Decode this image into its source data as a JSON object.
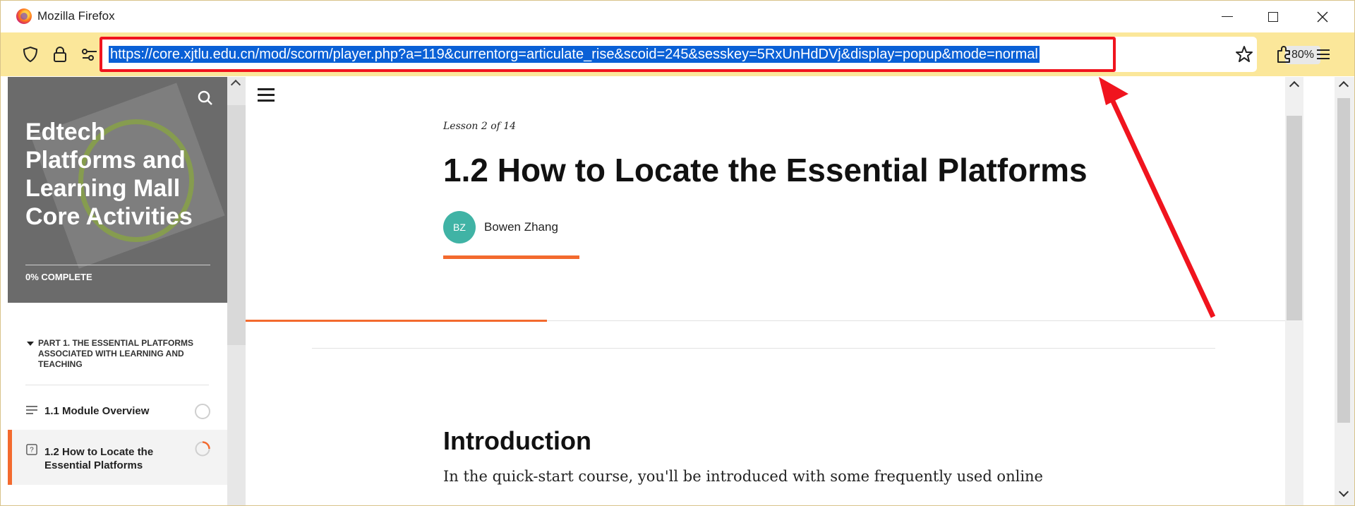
{
  "window": {
    "title": "Mozilla Firefox"
  },
  "navbar": {
    "url": "https://core.xjtlu.edu.cn/mod/scorm/player.php?a=119&currentorg=articulate_rise&scoid=245&sesskey=5RxUnHdDVj&display=popup&mode=normal",
    "zoom": "80%"
  },
  "sidebar": {
    "course_title": "Edtech Platforms and Learning Mall Core Activities",
    "progress_text": "0% COMPLETE",
    "part_heading": "PART 1. THE ESSENTIAL PLATFORMS ASSOCIATED WITH LEARNING AND TEACHING",
    "lessons": [
      {
        "label": "1.1 Module Overview"
      },
      {
        "label": "1.2 How to Locate the Essential Platforms"
      }
    ]
  },
  "content": {
    "lesson_count": "Lesson 2 of 14",
    "lesson_title": "1.2 How to Locate the Essential Platforms",
    "author_initials": "BZ",
    "author_name": "Bowen Zhang",
    "section_title": "Introduction",
    "section_body": "In the quick-start course, you'll be introduced with some frequently used online"
  },
  "colors": {
    "accent": "#f36a2e",
    "highlight_box": "#f0141e",
    "toolbar": "#fbe79a",
    "avatar": "#40b3a5",
    "url_selection": "#0a60d6"
  },
  "icons": [
    "firefox-logo-icon",
    "shield-icon",
    "lock-icon",
    "permissions-icon",
    "bookmark-star-icon",
    "extensions-icon",
    "menu-icon",
    "search-icon",
    "hamburger-icon",
    "lines-icon",
    "question-icon"
  ]
}
